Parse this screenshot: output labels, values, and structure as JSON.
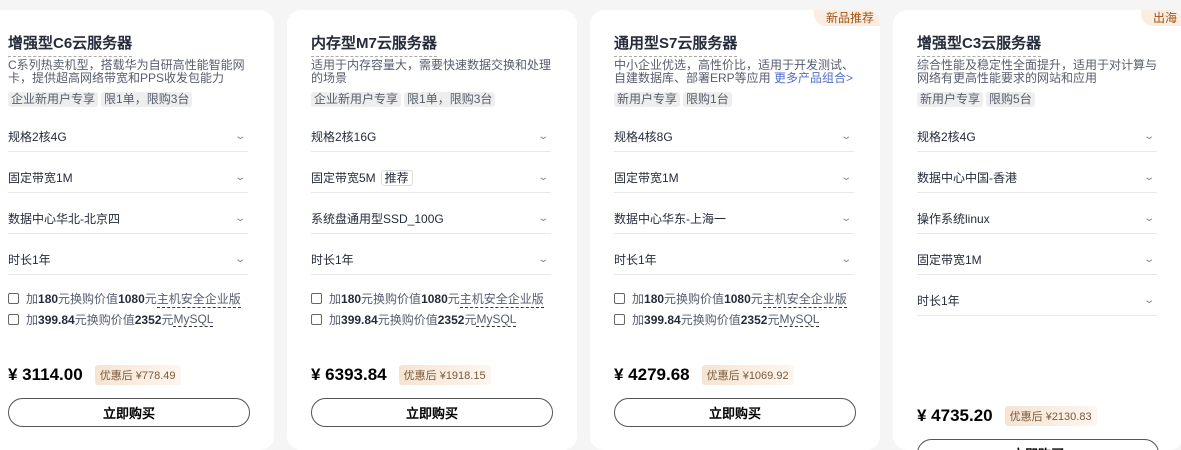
{
  "cards": [
    {
      "badge": null,
      "title": "增强型C6云服务器",
      "desc": "C系列热卖机型，搭载华为自研高性能智能网卡，提供超高网络带宽和PPS收发包能力",
      "desc_link": null,
      "tags": [
        "企业新用户专享",
        "限1单，限购3台"
      ],
      "selects": [
        "规格2核4G",
        "固定带宽1M",
        "数据中心华北-北京四",
        "时长1年"
      ],
      "options": [
        {
          "pre": "加",
          "a": "180",
          "mid": "元换购价值",
          "b": "1080",
          "post": "元",
          "item": "主机安全企业版"
        },
        {
          "pre": "加",
          "a": "399.84",
          "mid": "元换购价值",
          "b": "2352",
          "post": "元",
          "item": "MySQL"
        }
      ],
      "price": "¥ 3114.00",
      "discount": "优惠后 ¥778.49",
      "buy": "立即购买"
    },
    {
      "badge": null,
      "title": "内存型M7云服务器",
      "desc": "适用于内存容量大，需要快速数据交换和处理的场景",
      "desc_link": null,
      "tags": [
        "企业新用户专享",
        "限1单，限购3台"
      ],
      "selects": [
        "规格2核16G",
        "固定带宽5M",
        "系统盘通用型SSD_100G",
        "时长1年"
      ],
      "recommend": "推荐",
      "options": [
        {
          "pre": "加",
          "a": "180",
          "mid": "元换购价值",
          "b": "1080",
          "post": "元",
          "item": "主机安全企业版"
        },
        {
          "pre": "加",
          "a": "399.84",
          "mid": "元换购价值",
          "b": "2352",
          "post": "元",
          "item": "MySQL"
        }
      ],
      "price": "¥ 6393.84",
      "discount": "优惠后 ¥1918.15",
      "buy": "立即购买"
    },
    {
      "badge": "新品推荐",
      "title": "通用型S7云服务器",
      "desc": "中小企业优选，高性价比，适用于开发测试、自建数据库、部署ERP等应用 ",
      "desc_link": "更多产品组合>",
      "tags": [
        "新用户专享",
        "限购1台"
      ],
      "selects": [
        "规格4核8G",
        "固定带宽1M",
        "数据中心华东-上海一",
        "时长1年"
      ],
      "options": [
        {
          "pre": "加",
          "a": "180",
          "mid": "元换购价值",
          "b": "1080",
          "post": "元",
          "item": "主机安全企业版"
        },
        {
          "pre": "加",
          "a": "399.84",
          "mid": "元换购价值",
          "b": "2352",
          "post": "元",
          "item": "MySQL"
        }
      ],
      "price": "¥ 4279.68",
      "discount": "优惠后 ¥1069.92",
      "buy": "立即购买"
    },
    {
      "badge": "出海",
      "title": "增强型C3云服务器",
      "desc": "综合性能及稳定性全面提升，适用于对计算与网络有更高性能要求的网站和应用",
      "desc_link": null,
      "tags": [
        "新用户专享",
        "限购5台"
      ],
      "selects": [
        "规格2核4G",
        "数据中心中国-香港",
        "操作系统linux",
        "固定带宽1M",
        "时长1年"
      ],
      "options": [],
      "price": "¥ 4735.20",
      "discount": "优惠后 ¥2130.83",
      "buy": "立即购买"
    }
  ]
}
